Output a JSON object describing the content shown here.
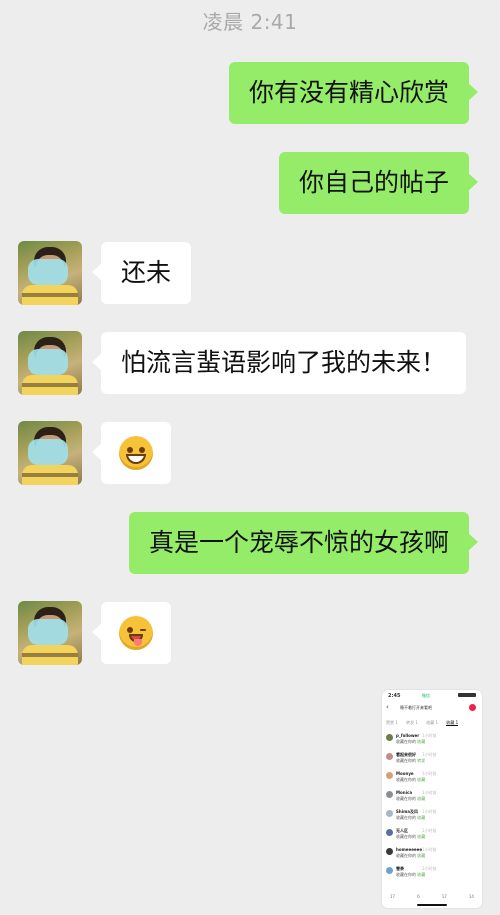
{
  "header": {
    "timestamp": "凌晨 2:41"
  },
  "messages": [
    {
      "side": "out",
      "text": "你有没有精心欣赏"
    },
    {
      "side": "out",
      "text": "你自己的帖子"
    },
    {
      "side": "in",
      "text": "还未"
    },
    {
      "side": "in",
      "text": "怕流言蜚语影响了我的未来！"
    },
    {
      "side": "in",
      "emoji": "grin-emoji"
    },
    {
      "side": "out",
      "text": "真是一个宠辱不惊的女孩啊"
    },
    {
      "side": "in",
      "emoji": "wink-tongue-emoji"
    }
  ],
  "image_message": {
    "status_time": "2:45",
    "app_tag": "微信",
    "title": "睡不着打开来看吧",
    "tabs": [
      "赞赏 1",
      "转发 1",
      "收藏 1",
      "收藏 1"
    ],
    "comments": [
      {
        "name": "p_follower",
        "time": "1小时前",
        "prefix": "收藏在你的",
        "highlight": "收藏"
      },
      {
        "name": "看起来很好",
        "time": "1小时前",
        "prefix": "收藏在你的",
        "highlight": "转发"
      },
      {
        "name": "Moonye",
        "time": "1小时前",
        "prefix": "收藏在你的",
        "highlight": "收藏"
      },
      {
        "name": "Monica",
        "time": "1小时前",
        "prefix": "收藏在你的",
        "highlight": "收藏"
      },
      {
        "name": "Shima及风",
        "time": "1小时前",
        "prefix": "收藏在你的",
        "highlight": "收藏"
      },
      {
        "name": "无人区",
        "time": "1小时前",
        "prefix": "收藏在你的",
        "highlight": "收藏"
      },
      {
        "name": "homeeeeee",
        "time": "1小时前",
        "prefix": "收藏在你的",
        "highlight": "收藏"
      },
      {
        "name": "雪茶",
        "time": "1小时前",
        "prefix": "收藏在你的",
        "highlight": "收藏"
      }
    ],
    "footer": [
      "17",
      "6",
      "17",
      "14"
    ]
  }
}
